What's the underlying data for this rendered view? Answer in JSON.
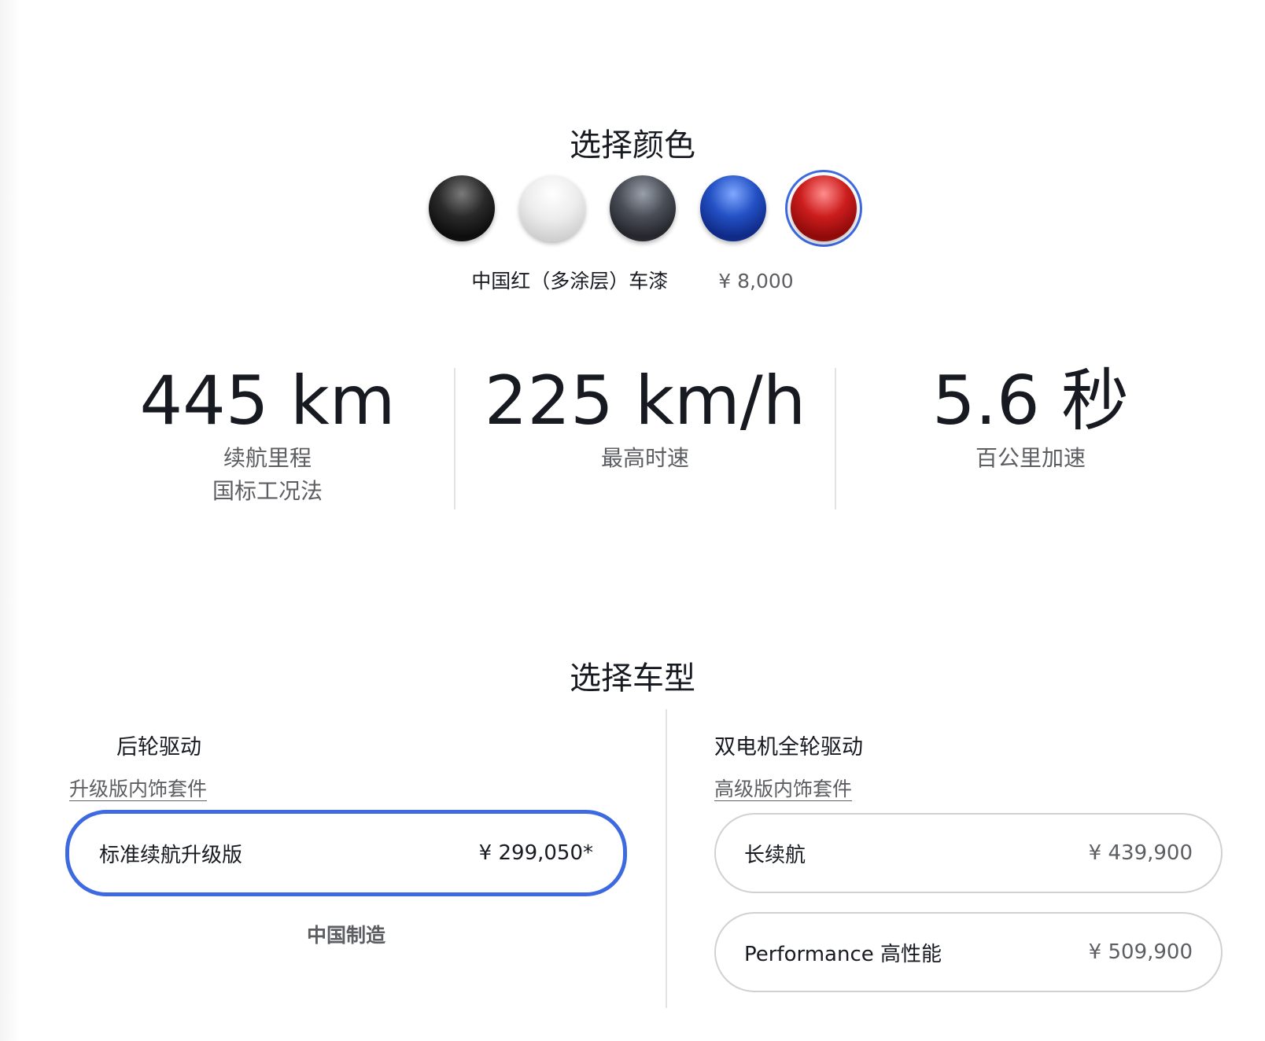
{
  "color_section": {
    "title": "选择颜色",
    "swatches": [
      {
        "name": "黑色",
        "color": "#1a1a1a",
        "selected": false
      },
      {
        "name": "白色",
        "color": "#e8e8e8",
        "selected": false
      },
      {
        "name": "深灰色",
        "color": "#3a3d44",
        "selected": false
      },
      {
        "name": "蓝色",
        "color": "#1a3aa8",
        "selected": false
      },
      {
        "name": "中国红",
        "color": "#b51414",
        "selected": true
      }
    ],
    "selected_name": "中国红（多涂层）车漆",
    "selected_price": "¥ 8,000"
  },
  "specs": [
    {
      "value": "445 km",
      "label_line1": "续航里程",
      "label_line2": "国标工况法"
    },
    {
      "value": "225 km/h",
      "label_line1": "最高时速",
      "label_line2": ""
    },
    {
      "value": "5.6 秒",
      "label_line1": "百公里加速",
      "label_line2": ""
    }
  ],
  "model_section": {
    "title": "选择车型",
    "rwd": {
      "title": "后轮驱动",
      "interior_link": "升级版内饰套件",
      "options": [
        {
          "name": "标准续航升级版",
          "price": "¥ 299,050*",
          "selected": true
        }
      ],
      "made_in": "中国制造"
    },
    "awd": {
      "title": "双电机全轮驱动",
      "interior_link": "高级版内饰套件",
      "options": [
        {
          "name": "长续航",
          "price": "¥ 439,900",
          "selected": false
        },
        {
          "name": "Performance 高性能",
          "price": "¥ 509,900",
          "selected": false
        }
      ]
    }
  },
  "colors": {
    "accent": "#3e6ae1",
    "text_primary": "#171a20",
    "text_secondary": "#5c5e62",
    "divider": "#e2e3e3"
  }
}
